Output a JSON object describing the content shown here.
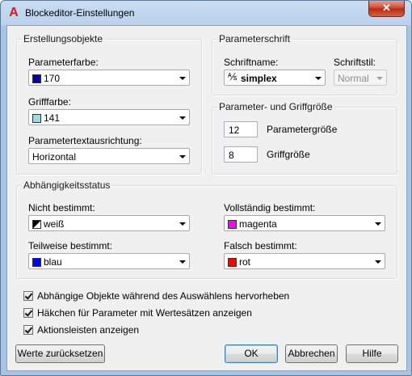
{
  "window": {
    "title": "Blockeditor-Einstellungen",
    "close_symbol": "✕"
  },
  "erstellungsobjekte": {
    "title": "Erstellungsobjekte",
    "parameterfarbe": {
      "label": "Parameterfarbe:",
      "value": "170",
      "color": "#0000aa"
    },
    "grifffarbe": {
      "label": "Grifffarbe:",
      "value": "141",
      "color": "#99d9ea"
    },
    "textausrichtung": {
      "label": "Parametertextausrichtung:",
      "value": "Horizontal"
    }
  },
  "parameterschrift": {
    "title": "Parameterschrift",
    "schriftname_label": "Schriftname:",
    "schriftname_value": "simplex",
    "schriftstil_label": "Schriftstil:",
    "schriftstil_value": "Normal"
  },
  "groesse": {
    "title": "Parameter- und Griffgröße",
    "parametergroesse_value": "12",
    "parametergroesse_label": "Parametergröße",
    "griffgroesse_value": "8",
    "griffgroesse_label": "Griffgröße"
  },
  "abhaengigkeitsstatus": {
    "title": "Abhängigkeitsstatus",
    "nicht_bestimmt": {
      "label": "Nicht bestimmt:",
      "value": "weiß",
      "color": "#ffffff"
    },
    "vollstaendig_bestimmt": {
      "label": "Vollständig bestimmt:",
      "value": "magenta",
      "color": "#ff00ff"
    },
    "teilweise_bestimmt": {
      "label": "Teilweise bestimmt:",
      "value": "blau",
      "color": "#0000ff"
    },
    "falsch_bestimmt": {
      "label": "Falsch bestimmt:",
      "value": "rot",
      "color": "#ff0000"
    }
  },
  "checkboxes": [
    {
      "label": "Abhängige Objekte während des Auswählens hervorheben",
      "checked": true
    },
    {
      "label": "Häkchen für Parameter mit Wertesätzen anzeigen",
      "checked": true
    },
    {
      "label": "Aktionsleisten anzeigen",
      "checked": true
    }
  ],
  "buttons": {
    "reset": "Werte zurücksetzen",
    "ok": "OK",
    "cancel": "Abbrechen",
    "help": "Hilfe"
  }
}
